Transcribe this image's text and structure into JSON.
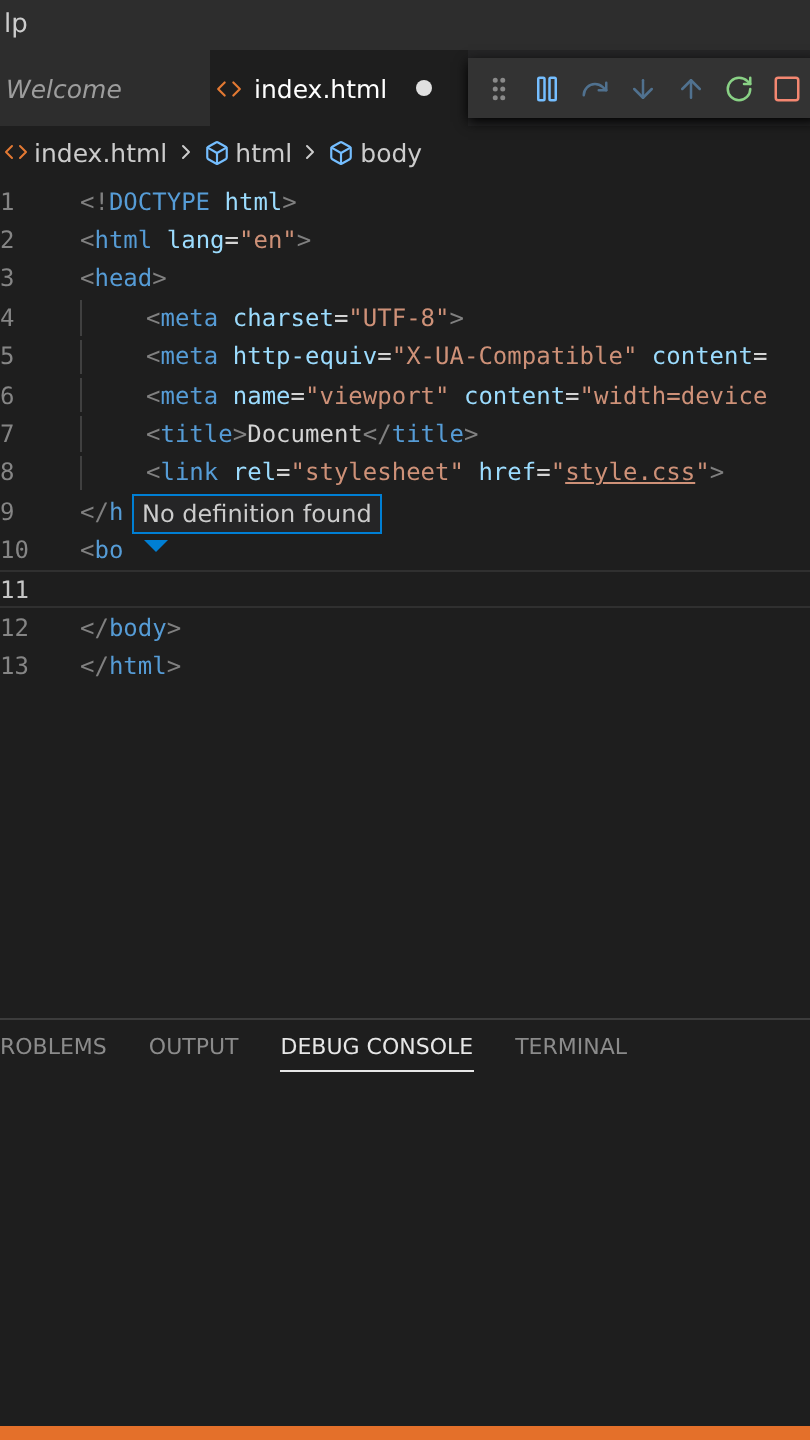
{
  "menu": {
    "label": "lp"
  },
  "tabs": [
    {
      "label": "Welcome",
      "selected": false,
      "preview": true,
      "modified": false
    },
    {
      "label": "index.html",
      "selected": true,
      "preview": false,
      "modified": true
    }
  ],
  "debug_toolbar": [
    {
      "kind": "grip",
      "disabled": false
    },
    {
      "kind": "pause",
      "disabled": false
    },
    {
      "kind": "step-over",
      "disabled": true
    },
    {
      "kind": "step-into",
      "disabled": true
    },
    {
      "kind": "step-out",
      "disabled": true
    },
    {
      "kind": "restart",
      "disabled": false
    },
    {
      "kind": "stop",
      "disabled": false
    }
  ],
  "breadcrumbs": [
    {
      "label": "index.html",
      "kind": "file"
    },
    {
      "label": "html",
      "kind": "element"
    },
    {
      "label": "body",
      "kind": "element"
    }
  ],
  "code_lines": [
    {
      "number": "1",
      "current": false,
      "tokens": [
        {
          "t": "<!",
          "kind": "punct"
        },
        {
          "t": "DOCTYPE",
          "kind": "tag"
        },
        {
          "t": " html",
          "kind": "attr"
        },
        {
          "t": ">",
          "kind": "punct"
        }
      ]
    },
    {
      "number": "2",
      "current": false,
      "tokens": [
        {
          "t": "<",
          "kind": "punct"
        },
        {
          "t": "html",
          "kind": "tag"
        },
        {
          "t": " lang",
          "kind": "attr"
        },
        {
          "t": "=",
          "kind": "text"
        },
        {
          "t": "\"en\"",
          "kind": "str"
        },
        {
          "t": ">",
          "kind": "punct"
        }
      ]
    },
    {
      "number": "3",
      "current": false,
      "tokens": [
        {
          "t": "<",
          "kind": "punct"
        },
        {
          "t": "head",
          "kind": "tag"
        },
        {
          "t": ">",
          "kind": "punct"
        }
      ],
      "children": [
        {
          "number": "4",
          "current": false,
          "tokens": [
            {
              "t": "<",
              "kind": "punct"
            },
            {
              "t": "meta",
              "kind": "tag"
            },
            {
              "t": " charset",
              "kind": "attr"
            },
            {
              "t": "=",
              "kind": "text"
            },
            {
              "t": "\"UTF-8\"",
              "kind": "str"
            },
            {
              "t": ">",
              "kind": "punct"
            }
          ]
        },
        {
          "number": "5",
          "current": false,
          "tokens": [
            {
              "t": "<",
              "kind": "punct"
            },
            {
              "t": "meta",
              "kind": "tag"
            },
            {
              "t": " http-equiv",
              "kind": "attr"
            },
            {
              "t": "=",
              "kind": "text"
            },
            {
              "t": "\"X-UA-Compatible\"",
              "kind": "str"
            },
            {
              "t": " content",
              "kind": "attr"
            },
            {
              "t": "=",
              "kind": "text"
            }
          ]
        },
        {
          "number": "6",
          "current": false,
          "tokens": [
            {
              "t": "<",
              "kind": "punct"
            },
            {
              "t": "meta",
              "kind": "tag"
            },
            {
              "t": " name",
              "kind": "attr"
            },
            {
              "t": "=",
              "kind": "text"
            },
            {
              "t": "\"viewport\"",
              "kind": "str"
            },
            {
              "t": " content",
              "kind": "attr"
            },
            {
              "t": "=",
              "kind": "text"
            },
            {
              "t": "\"width=device",
              "kind": "str"
            }
          ]
        },
        {
          "number": "7",
          "current": false,
          "tokens": [
            {
              "t": "<",
              "kind": "punct"
            },
            {
              "t": "title",
              "kind": "tag"
            },
            {
              "t": ">",
              "kind": "punct"
            },
            {
              "t": "Document",
              "kind": "text"
            },
            {
              "t": "</",
              "kind": "punct"
            },
            {
              "t": "title",
              "kind": "tag"
            },
            {
              "t": ">",
              "kind": "punct"
            }
          ]
        },
        {
          "number": "8",
          "current": false,
          "tokens": [
            {
              "t": "<",
              "kind": "punct"
            },
            {
              "t": "link",
              "kind": "tag"
            },
            {
              "t": " rel",
              "kind": "attr"
            },
            {
              "t": "=",
              "kind": "text"
            },
            {
              "t": "\"stylesheet\"",
              "kind": "str"
            },
            {
              "t": " href",
              "kind": "attr"
            },
            {
              "t": "=",
              "kind": "text"
            },
            {
              "t": "\"",
              "kind": "str"
            },
            {
              "t": "style.css",
              "kind": "link"
            },
            {
              "t": "\"",
              "kind": "str"
            },
            {
              "t": ">",
              "kind": "punct"
            }
          ]
        }
      ]
    },
    {
      "number": "9",
      "current": false,
      "tokens": [
        {
          "t": "</",
          "kind": "punct"
        },
        {
          "t": "h",
          "kind": "tag"
        }
      ]
    },
    {
      "number": "10",
      "current": false,
      "tokens": [
        {
          "t": "<",
          "kind": "punct"
        },
        {
          "t": "bo",
          "kind": "tag"
        }
      ]
    },
    {
      "number": "11",
      "current": true
    },
    {
      "number": "12",
      "current": false,
      "tokens": [
        {
          "t": "</",
          "kind": "punct"
        },
        {
          "t": "body",
          "kind": "tag"
        },
        {
          "t": ">",
          "kind": "punct"
        }
      ]
    },
    {
      "number": "13",
      "current": false,
      "tokens": [
        {
          "t": "</",
          "kind": "punct"
        },
        {
          "t": "html",
          "kind": "tag"
        },
        {
          "t": ">",
          "kind": "punct"
        }
      ]
    }
  ],
  "hover_tooltip": {
    "text": "No definition found"
  },
  "panel_tabs": [
    {
      "label": "ROBLEMS",
      "selected": false
    },
    {
      "label": "OUTPUT",
      "selected": false
    },
    {
      "label": "DEBUG CONSOLE",
      "selected": true
    },
    {
      "label": "TERMINAL",
      "selected": false
    }
  ]
}
